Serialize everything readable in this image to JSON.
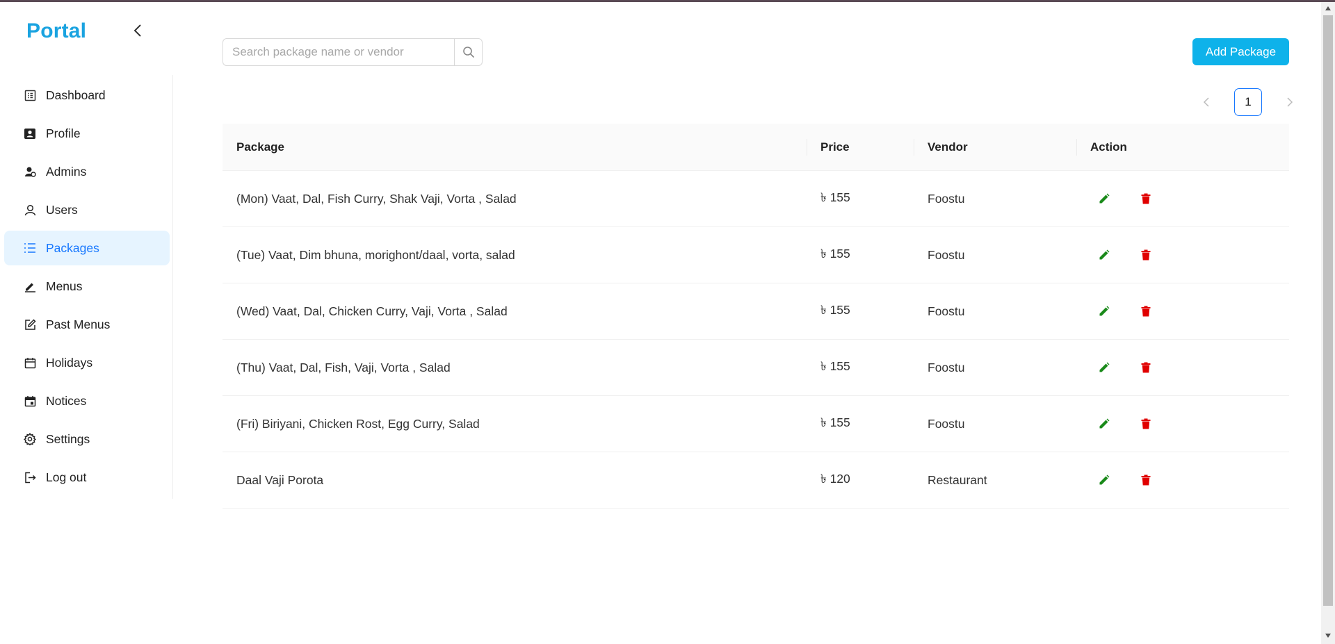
{
  "brand": "Portal",
  "sidebar": {
    "items": [
      {
        "label": "Dashboard",
        "icon": "dashboard-icon",
        "active": false
      },
      {
        "label": "Profile",
        "icon": "profile-card-icon",
        "active": false
      },
      {
        "label": "Admins",
        "icon": "admin-icon",
        "active": false
      },
      {
        "label": "Users",
        "icon": "user-icon",
        "active": false
      },
      {
        "label": "Packages",
        "icon": "list-icon",
        "active": true
      },
      {
        "label": "Menus",
        "icon": "pen-icon",
        "active": false
      },
      {
        "label": "Past Menus",
        "icon": "edit-square-icon",
        "active": false
      },
      {
        "label": "Holidays",
        "icon": "calendar-icon",
        "active": false
      },
      {
        "label": "Notices",
        "icon": "calendar-filled-icon",
        "active": false
      },
      {
        "label": "Settings",
        "icon": "gear-icon",
        "active": false
      },
      {
        "label": "Log out",
        "icon": "logout-icon",
        "active": false
      }
    ]
  },
  "search": {
    "placeholder": "Search package name or vendor",
    "value": ""
  },
  "toolbar": {
    "add_label": "Add Package"
  },
  "pagination": {
    "current": "1"
  },
  "table": {
    "headers": {
      "package": "Package",
      "price": "Price",
      "vendor": "Vendor",
      "action": "Action"
    },
    "rows": [
      {
        "package": "(Mon) Vaat, Dal, Fish Curry, Shak Vaji, Vorta , Salad",
        "price": "৳ 155",
        "vendor": "Foostu"
      },
      {
        "package": "(Tue) Vaat, Dim bhuna, morighont/daal, vorta, salad",
        "price": "৳ 155",
        "vendor": "Foostu"
      },
      {
        "package": "(Wed) Vaat, Dal, Chicken Curry, Vaji, Vorta , Salad",
        "price": "৳ 155",
        "vendor": "Foostu"
      },
      {
        "package": "(Thu) Vaat, Dal, Fish, Vaji, Vorta , Salad",
        "price": "৳ 155",
        "vendor": "Foostu"
      },
      {
        "package": "(Fri) Biriyani, Chicken Rost, Egg Curry, Salad",
        "price": "৳ 155",
        "vendor": "Foostu"
      },
      {
        "package": "Daal Vaji Porota",
        "price": "৳ 120",
        "vendor": "Restaurant"
      }
    ]
  },
  "colors": {
    "brand": "#1aa3e0",
    "accent": "#0eb2ea",
    "active_nav": "#1677ff",
    "edit": "#1a8a1a",
    "delete": "#e00000"
  }
}
